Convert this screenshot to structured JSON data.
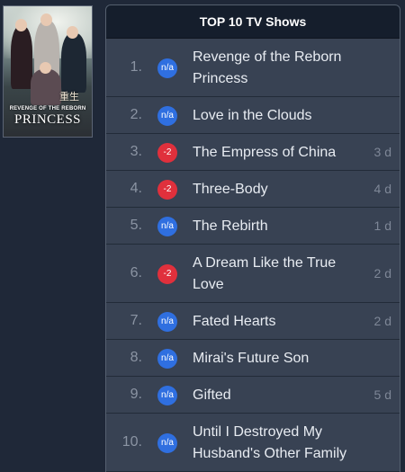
{
  "poster": {
    "title_small": "REVENGE OF THE REBORN",
    "title_big": "PRINCESS",
    "seal_text": "重生"
  },
  "panel": {
    "header": "TOP 10 TV Shows"
  },
  "shows": [
    {
      "rank": "1.",
      "badge": "n/a",
      "badge_type": "na",
      "title": "Revenge of the Reborn Princess",
      "days": ""
    },
    {
      "rank": "2.",
      "badge": "n/a",
      "badge_type": "na",
      "title": "Love in the Clouds",
      "days": ""
    },
    {
      "rank": "3.",
      "badge": "-2",
      "badge_type": "down",
      "title": "The Empress of China",
      "days": "3 d"
    },
    {
      "rank": "4.",
      "badge": "-2",
      "badge_type": "down",
      "title": "Three-Body",
      "days": "4 d"
    },
    {
      "rank": "5.",
      "badge": "n/a",
      "badge_type": "na",
      "title": "The Rebirth",
      "days": "1 d"
    },
    {
      "rank": "6.",
      "badge": "-2",
      "badge_type": "down",
      "title": "A Dream Like the True Love",
      "days": "2 d"
    },
    {
      "rank": "7.",
      "badge": "n/a",
      "badge_type": "na",
      "title": "Fated Hearts",
      "days": "2 d"
    },
    {
      "rank": "8.",
      "badge": "n/a",
      "badge_type": "na",
      "title": "Mirai's Future Son",
      "days": ""
    },
    {
      "rank": "9.",
      "badge": "n/a",
      "badge_type": "na",
      "title": "Gifted",
      "days": "5 d"
    },
    {
      "rank": "10.",
      "badge": "n/a",
      "badge_type": "na",
      "title": "Until I Destroyed My Husband's Other Family",
      "days": ""
    }
  ],
  "colors": {
    "badge_na": "#2f6fe0",
    "badge_down": "#e0303c",
    "panel_bg": "#384253",
    "header_bg": "#151e2c",
    "page_bg": "#1f2838"
  }
}
